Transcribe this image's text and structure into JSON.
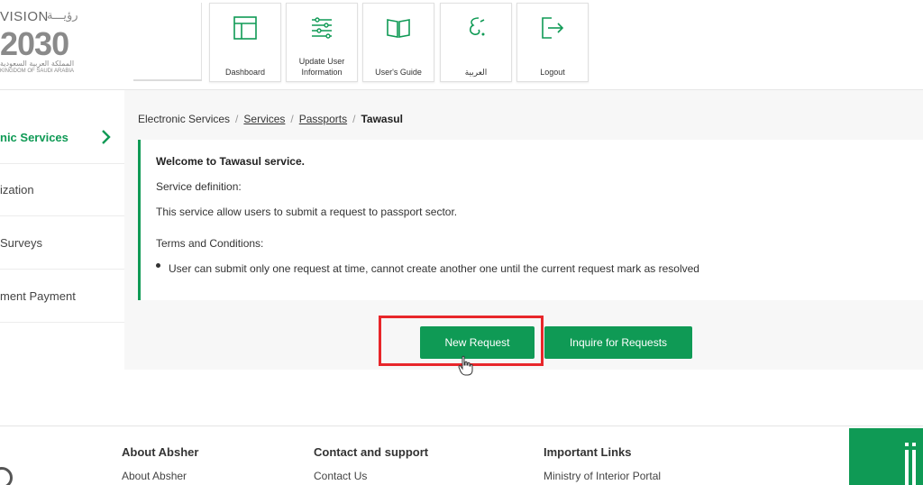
{
  "logo": {
    "vision": "VISION",
    "year": "2030",
    "arabic_top": "رؤيـــة",
    "arabic_mid": "المملكة العربية السعودية",
    "kingdom": "KINGDOM OF SAUDI ARABIA"
  },
  "nav": {
    "dashboard": "Dashboard",
    "update_line1": "Update User",
    "update_line2": "Information",
    "guide": "User's Guide",
    "arabic": "العربية",
    "logout": "Logout"
  },
  "sidebar": {
    "items": [
      {
        "label": "nic Services",
        "active": true
      },
      {
        "label": "ization",
        "active": false
      },
      {
        "label": "Surveys",
        "active": false
      },
      {
        "label": "ment Payment",
        "active": false
      }
    ]
  },
  "breadcrumb": {
    "electronic_services": "Electronic Services",
    "services": "Services",
    "passports": "Passports",
    "current": "Tawasul",
    "separator": "/"
  },
  "info": {
    "welcome": "Welcome to Tawasul service.",
    "definition_label": "Service definition:",
    "definition_text": "This service allow users to submit a request to passport sector.",
    "terms_label": "Terms and Conditions:",
    "term_1": "User can submit only one request at time, cannot create another one until the current request mark as resolved"
  },
  "buttons": {
    "new_request": "New Request",
    "inquire": "Inquire for Requests"
  },
  "footer": {
    "about_title": "About Absher",
    "about_link": "About Absher",
    "contact_title": "Contact and support",
    "contact_link": "Contact Us",
    "links_title": "Important Links",
    "links_link": "Ministry of Interior Portal"
  },
  "colors": {
    "accent": "#0f9a55",
    "highlight": "#e8262a"
  }
}
